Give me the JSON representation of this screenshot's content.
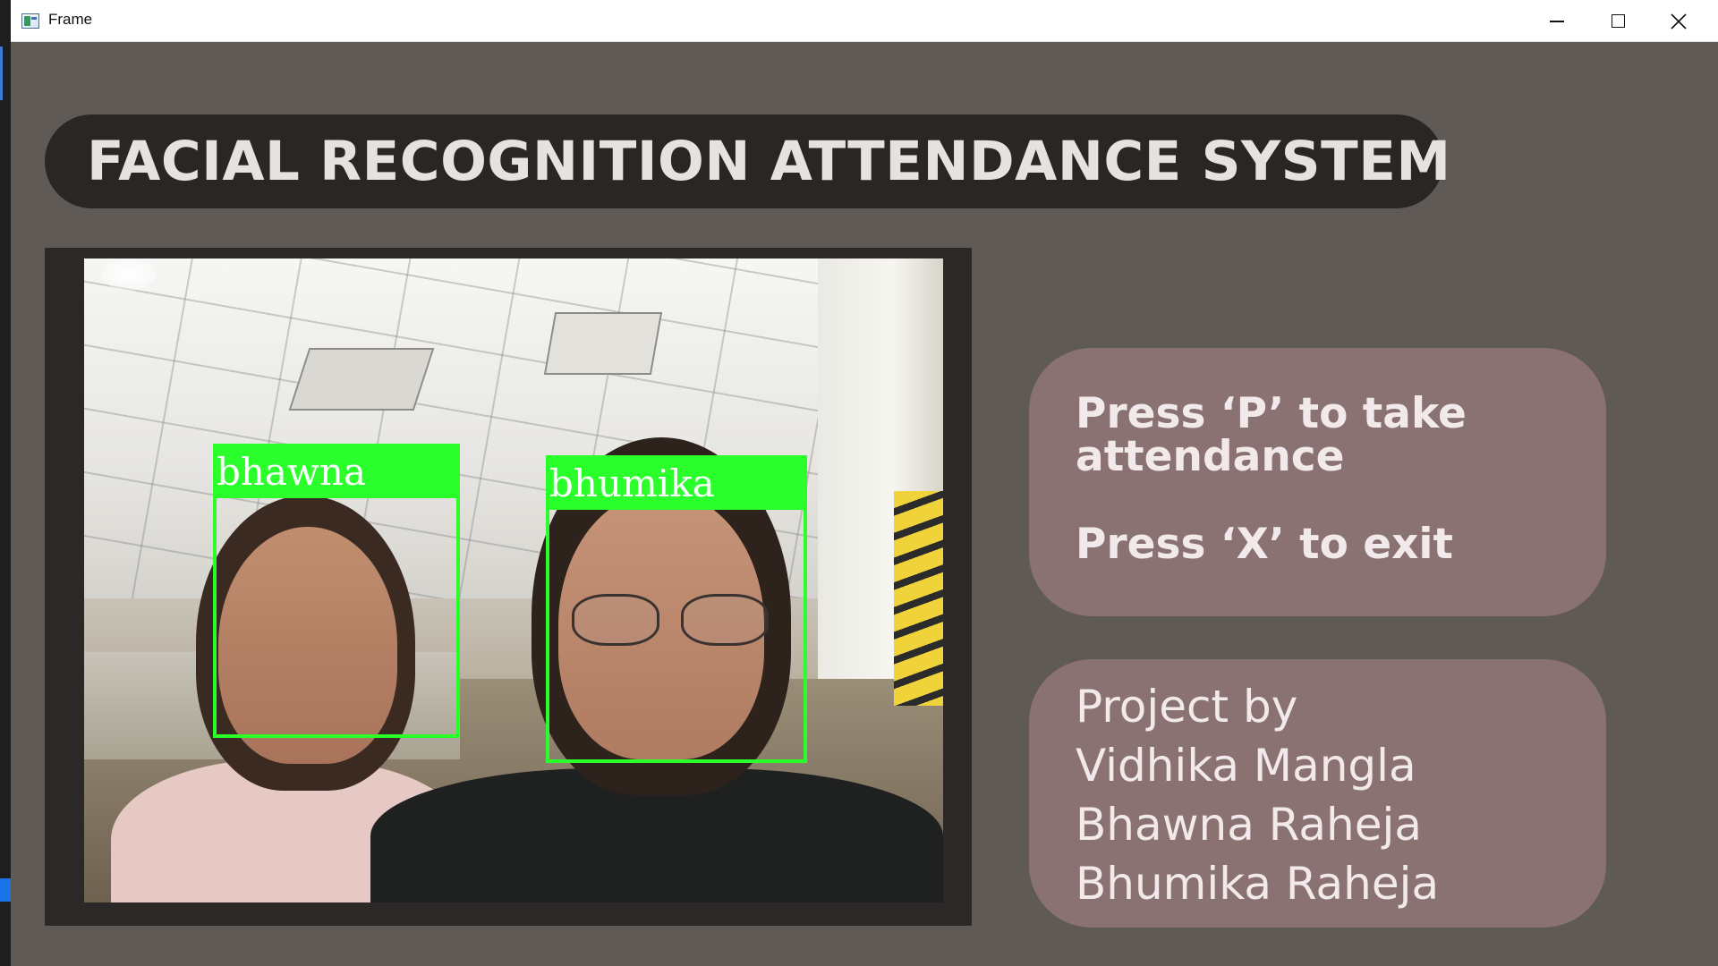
{
  "window": {
    "title": "Frame",
    "icon": "app-window-icon",
    "controls": [
      "minimize-icon",
      "maximize-icon",
      "close-icon"
    ]
  },
  "app": {
    "heading": "FACIAL RECOGNITION ATTENDANCE SYSTEM",
    "detections": [
      {
        "label": "bhawna",
        "box_color": "#2bff2b"
      },
      {
        "label": "bhumika",
        "box_color": "#2bff2b"
      }
    ],
    "instructions": {
      "line1": "Press ‘P’ to take",
      "line2": "attendance",
      "line3": "Press ‘X’ to exit"
    },
    "credits": {
      "line1": "Project by",
      "line2": "Vidhika Mangla",
      "line3": "Bhawna Raheja",
      "line4": "Bhumika Raheja"
    }
  },
  "colors": {
    "background": "#5f5a56",
    "title_pill": "#2a2625",
    "card": "#8a7172",
    "detection": "#2bff2b"
  }
}
